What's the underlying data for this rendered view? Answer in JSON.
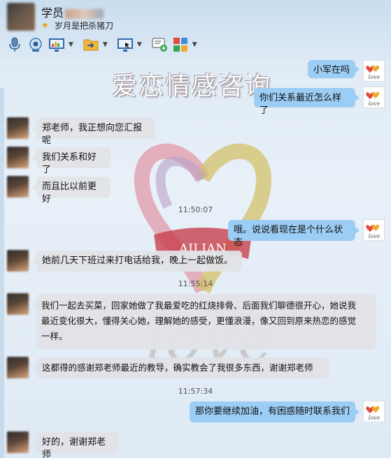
{
  "header": {
    "contact_prefix": "学员",
    "signature": "岁月是把杀猪刀"
  },
  "toolbar": {
    "items": [
      "microphone-icon",
      "webcam-icon",
      "screen-share-icon",
      "file-transfer-icon",
      "remote-desktop-icon",
      "message-add-icon",
      "apps-icon"
    ]
  },
  "watermark": {
    "title": "爱恋情感咨询",
    "logo_text": "AILIAN",
    "script_text": "love"
  },
  "colors": {
    "outgoing_bubble": "#9ccdf5",
    "incoming_bubble": "#e1e3e7"
  },
  "messages": [
    {
      "dir": "out",
      "text": "小军在吗"
    },
    {
      "dir": "out",
      "text": "你们关系最近怎么样了"
    },
    {
      "dir": "in",
      "text": "郑老师，我正想向您汇报呢"
    },
    {
      "dir": "in",
      "text": "我们关系和好了"
    },
    {
      "dir": "in",
      "text": "而且比以前更好"
    },
    {
      "dir": "ts",
      "text": "11:50:07"
    },
    {
      "dir": "out",
      "text": "哦。说说看现在是个什么状态"
    },
    {
      "dir": "in",
      "text": "她前几天下班过来打电话给我，晚上一起做饭。"
    },
    {
      "dir": "ts",
      "text": "11:55:14"
    },
    {
      "dir": "in",
      "lines": [
        "我们一起去买菜，回家她做了我最爱吃的红烧排骨、后面我们聊德很开心，她说我",
        "最近变化很大，懂得关心她，理解她的感受，更懂浪漫，像又回到原来热恋的感觉",
        "一样。"
      ]
    },
    {
      "dir": "in",
      "text": "这都得的感谢郑老师最近的教导，确实教会了我很多东西，谢谢郑老师"
    },
    {
      "dir": "ts",
      "text": "11:57:34"
    },
    {
      "dir": "out",
      "text": "那你要继续加油，有困惑随时联系我们"
    },
    {
      "dir": "in",
      "text": "好的，谢谢郑老师"
    }
  ]
}
